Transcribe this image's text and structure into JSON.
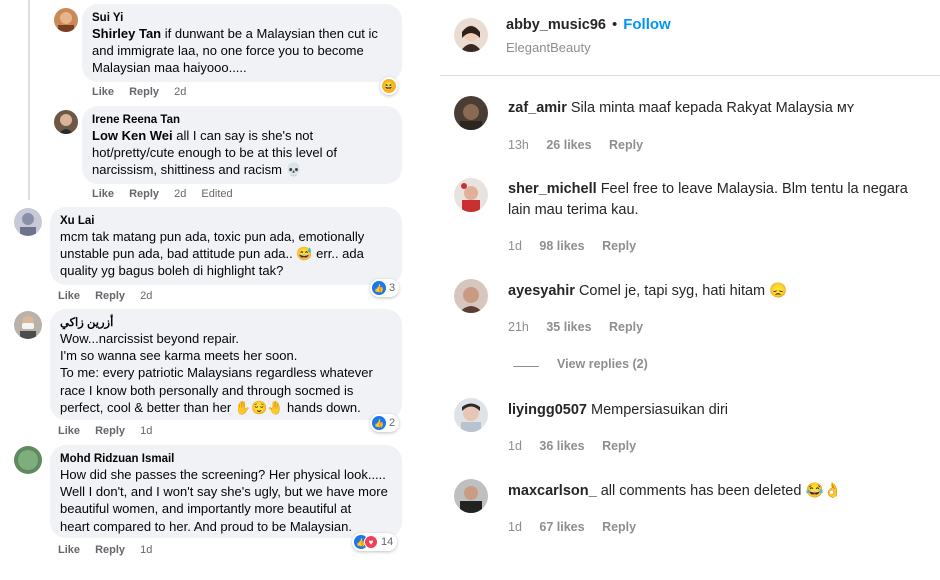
{
  "facebook": {
    "comments": [
      {
        "author": "Sui Yi",
        "tag": "Shirley Tan",
        "lines": [
          " if dunwant be a Malaysian then cut ic",
          "and immigrate laa, no one force you to become",
          "Malaysian maa haiyooo....."
        ],
        "like": "Like",
        "reply": "Reply",
        "time": "2d",
        "reactions": [
          "haha"
        ]
      },
      {
        "author": "Irene Reena Tan",
        "tag": "Low Ken Wei",
        "lines": [
          " all I can say is she's not",
          "hot/pretty/cute enough to be at this level of",
          "narcissism, shittiness and racism 💀"
        ],
        "like": "Like",
        "reply": "Reply",
        "time": "2d",
        "edited": "Edited"
      },
      {
        "author": "Xu Lai",
        "lines": [
          "mcm tak matang pun ada, toxic pun ada, emotionally",
          "unstable pun ada, bad attitude pun ada.. 😅 err.. ada",
          "quality yg bagus boleh di highlight tak?"
        ],
        "like": "Like",
        "reply": "Reply",
        "time": "2d",
        "reaction_count": "3"
      },
      {
        "author": "أزرين زاكي",
        "lines": [
          "Wow...narcissist beyond repair.",
          "I'm so wanna see karma meets her soon.",
          "To me: every patriotic Malaysians regardless whatever",
          "race I know both personally and through socmed is",
          "perfect, cool & better than her ✋😌🤚 hands down."
        ],
        "like": "Like",
        "reply": "Reply",
        "time": "1d",
        "reaction_count": "2"
      },
      {
        "author": "Mohd Ridzuan Ismail",
        "lines": [
          "How did she passes the screening? Her physical look.....",
          "Well I don't, and I won't say she's ugly, but we have more",
          "beautiful women, and importantly more beautiful at",
          "heart compared to her. And proud to be Malaysian."
        ],
        "like": "Like",
        "reply": "Reply",
        "time": "1d",
        "reaction_count": "14"
      }
    ]
  },
  "instagram": {
    "header": {
      "username": "abby_music96",
      "follow": "Follow",
      "subtitle": "ElegantBeauty"
    },
    "comments": [
      {
        "username": "zaf_amir",
        "text": "Sila minta maaf kepada Rakyat Malaysia ᴍʏ",
        "time": "13h",
        "likes": "26 likes",
        "reply": "Reply"
      },
      {
        "username": "sher_michell",
        "text": "Feel free to leave Malaysia. Blm tentu la negara",
        "text2": "lain mau terima kau.",
        "time": "1d",
        "likes": "98 likes",
        "reply": "Reply"
      },
      {
        "username": "ayesyahir",
        "text": "Comel je, tapi syg, hati hitam 😞",
        "time": "21h",
        "likes": "35 likes",
        "reply": "Reply",
        "view_replies": "View replies (2)"
      },
      {
        "username": "liyingg0507",
        "text": "Mempersiasuikan diri",
        "time": "1d",
        "likes": "36 likes",
        "reply": "Reply"
      },
      {
        "username": "maxcarlson_",
        "text": "all comments has been deleted 😂👌",
        "time": "1d",
        "likes": "67 likes",
        "reply": "Reply"
      }
    ]
  }
}
